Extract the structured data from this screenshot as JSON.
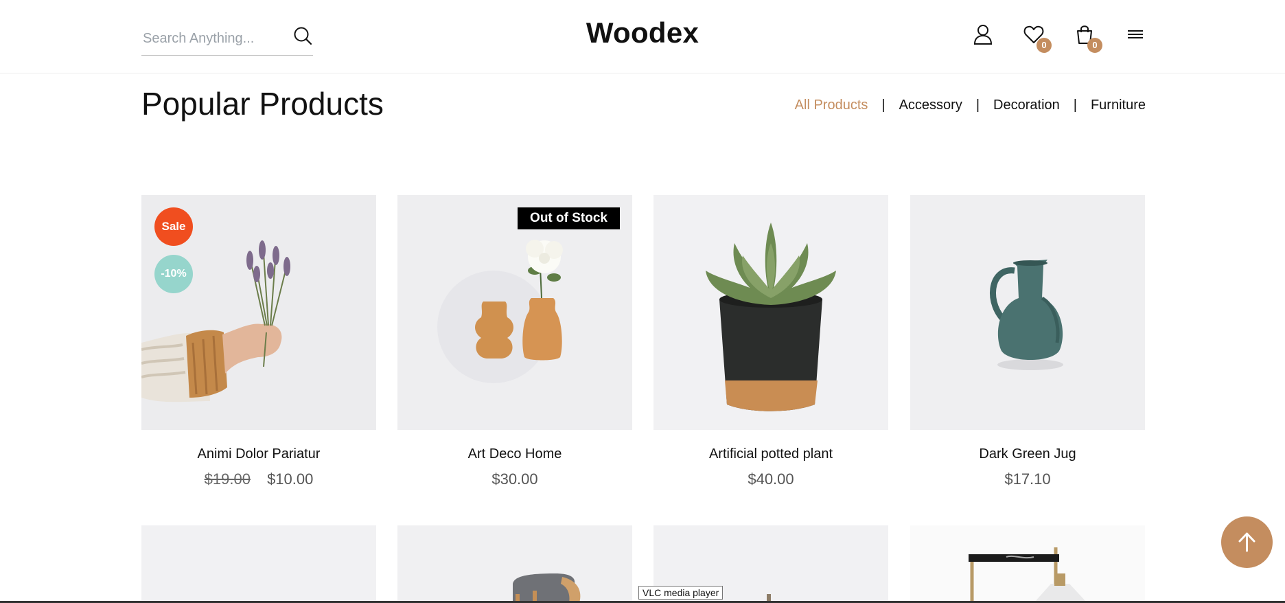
{
  "header": {
    "logo": "Woodex",
    "search": {
      "placeholder": "Search Anything...",
      "value": ""
    },
    "wishlist_count": "0",
    "cart_count": "0"
  },
  "section": {
    "title": "Popular Products",
    "filters": [
      "All Products",
      "Accessory",
      "Decoration",
      "Furniture"
    ],
    "active_filter": "All Products"
  },
  "products": [
    {
      "name": "Animi Dolor Pariatur",
      "old_price": "$19.00",
      "price": "$10.00",
      "badges": [
        "Sale",
        "-10%"
      ]
    },
    {
      "name": "Art Deco Home",
      "price": "$30.00",
      "badges": [
        "Out of Stock"
      ]
    },
    {
      "name": "Artificial potted plant",
      "price": "$40.00"
    },
    {
      "name": "Dark Green Jug",
      "price": "$17.10"
    }
  ],
  "tooltip": "VLC media player",
  "colors": {
    "accent": "#c48d5f",
    "sale": "#f04e1f",
    "discount": "#96d5cc"
  }
}
